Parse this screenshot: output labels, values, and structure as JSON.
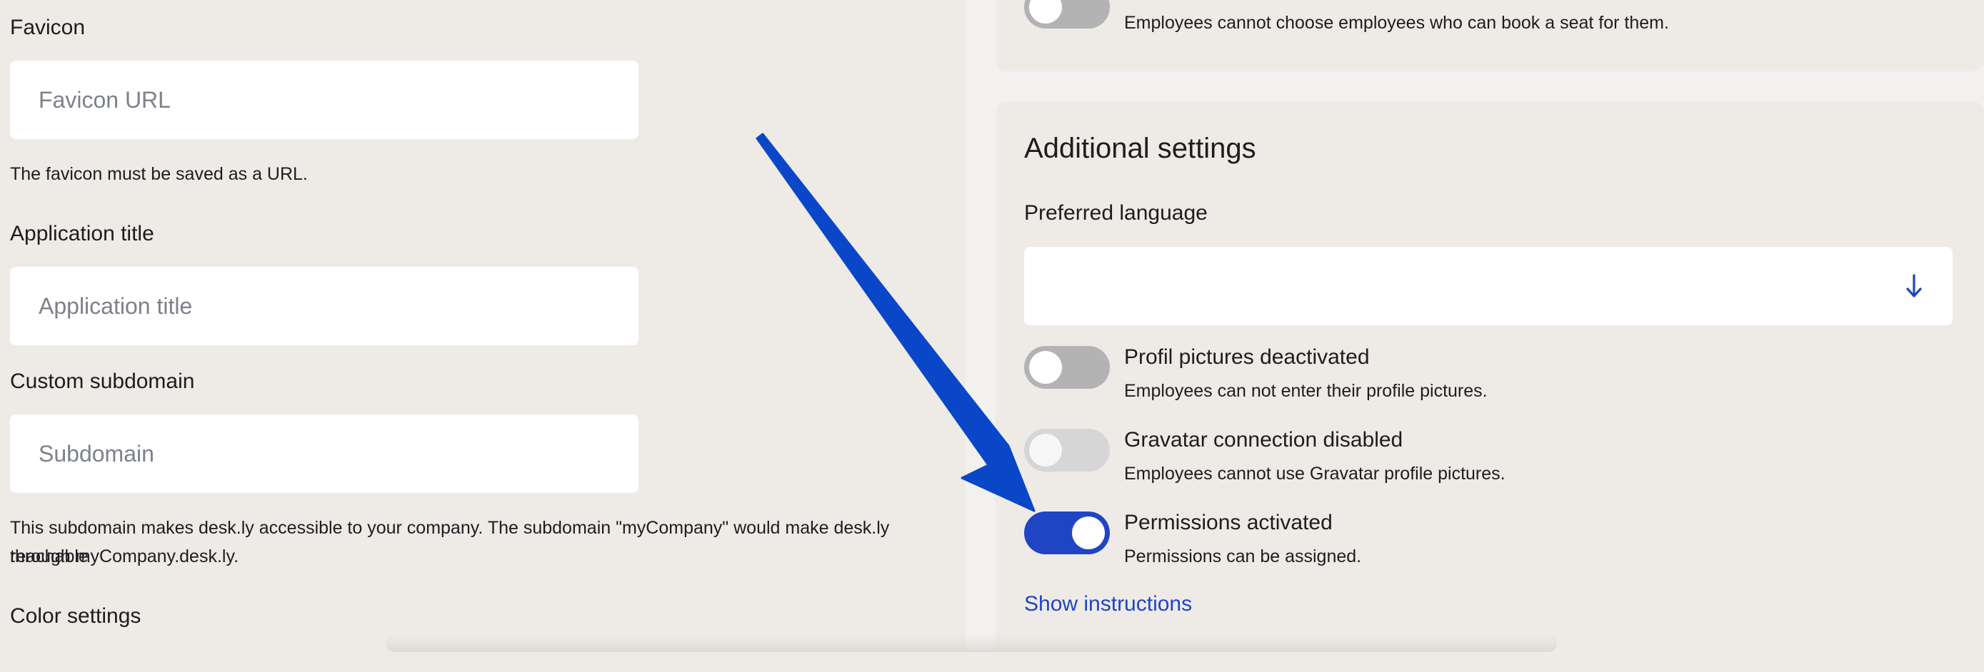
{
  "left": {
    "favicon": {
      "label": "Favicon",
      "placeholder": "Favicon URL",
      "help": "The favicon must be saved as a URL."
    },
    "app_title": {
      "label": "Application title",
      "placeholder": "Application title"
    },
    "subdomain": {
      "label": "Custom subdomain",
      "placeholder": "Subdomain",
      "help_line1": "This subdomain makes desk.ly accessible to your company. The subdomain \"myCompany\" would make desk.ly reachable",
      "help_line2": "through myCompany.desk.ly."
    },
    "color_settings": "Color settings"
  },
  "right": {
    "top_card": {
      "desc": "Employees cannot choose employees who can book a seat for them."
    },
    "additional": {
      "title": "Additional settings",
      "preferred_language_label": "Preferred language",
      "preferred_language_value": "",
      "toggles": [
        {
          "title": "Profil pictures deactivated",
          "desc": "Employees can not enter their profile pictures.",
          "state": "off"
        },
        {
          "title": "Gravatar connection disabled",
          "desc": "Employees cannot use Gravatar profile pictures.",
          "state": "disabled"
        },
        {
          "title": "Permissions activated",
          "desc": "Permissions can be assigned.",
          "state": "on"
        }
      ],
      "show_instructions": "Show instructions"
    }
  },
  "colors": {
    "accent": "#1f45c4",
    "annotation_arrow": "#0a47c8"
  },
  "icons": {
    "select_arrow": "arrow-down-icon",
    "annotation": "annotation-arrow-icon"
  }
}
